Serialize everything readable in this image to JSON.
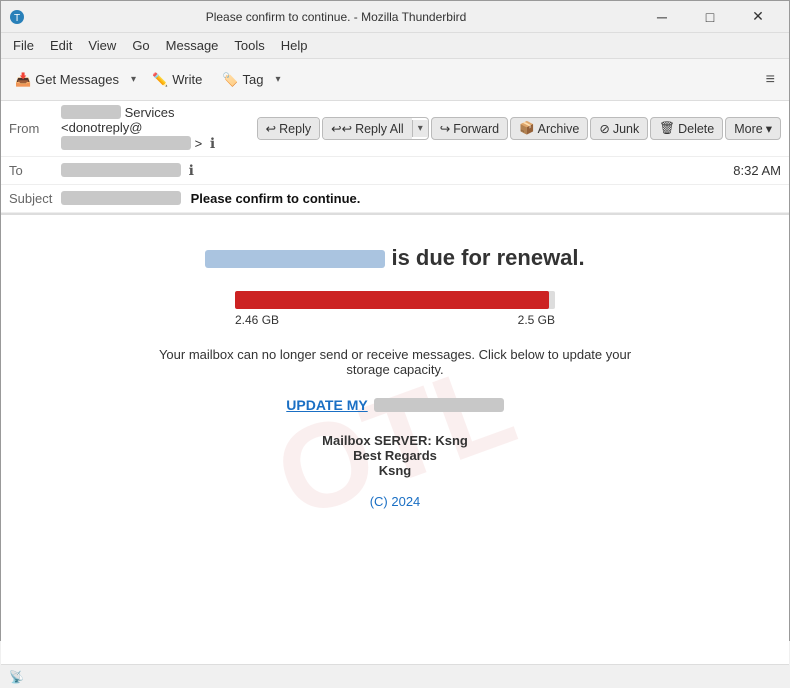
{
  "window": {
    "title": "Please confirm to continue. - Mozilla Thunderbird",
    "icon": "🦅"
  },
  "titlebar": {
    "minimize_label": "─",
    "maximize_label": "□",
    "close_label": "✕"
  },
  "menubar": {
    "items": [
      {
        "label": "File"
      },
      {
        "label": "Edit"
      },
      {
        "label": "View"
      },
      {
        "label": "Go"
      },
      {
        "label": "Message"
      },
      {
        "label": "Tools"
      },
      {
        "label": "Help"
      }
    ]
  },
  "toolbar": {
    "get_messages_label": "Get Messages",
    "write_label": "Write",
    "tag_label": "Tag",
    "hamburger_label": "≡"
  },
  "action_buttons": {
    "reply_label": "Reply",
    "reply_all_label": "Reply All",
    "forward_label": "Forward",
    "archive_label": "Archive",
    "junk_label": "Junk",
    "delete_label": "Delete",
    "more_label": "More"
  },
  "email_header": {
    "from_label": "From",
    "from_service": "Services <donotreply@",
    "to_label": "To",
    "subject_label": "Subject",
    "subject_prefix": "",
    "subject_bold": "Please confirm to continue.",
    "time": "8:32 AM"
  },
  "email_body": {
    "renewal_intro": " is due for renewal.",
    "storage_used": "2.46 GB",
    "storage_total": "2.5 GB",
    "storage_pct": 98,
    "storage_msg": "Your mailbox can no longer send or receive messages. Click below to update your storage capacity.",
    "update_prefix": "UPDATE MY",
    "footer_server": "Mailbox SERVER: Ksng",
    "footer_regards": "Best Regards",
    "footer_name": "Ksng",
    "copyright": "(C) 2024"
  },
  "statusbar": {
    "icon": "📡",
    "text": ""
  }
}
